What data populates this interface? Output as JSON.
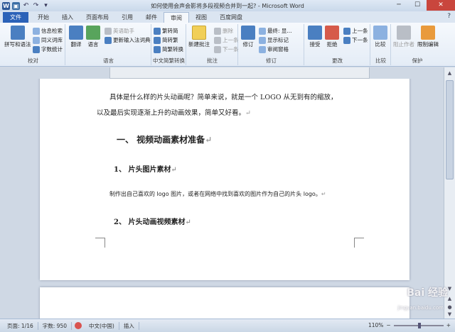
{
  "window": {
    "title": "如何使用会声会影将多段视频合并到一起? - Microsoft Word",
    "minimize": "─",
    "maximize": "☐",
    "close": "✕"
  },
  "quick_access": {
    "app_icon": "W",
    "save": "▣",
    "undo": "↶",
    "redo": "↷",
    "more": "▾"
  },
  "tabs": [
    "文件",
    "开始",
    "插入",
    "页面布局",
    "引用",
    "邮件",
    "审阅",
    "视图",
    "百度网盘"
  ],
  "active_tab": "审阅",
  "help_icon": "?",
  "ribbon": {
    "proofing": {
      "label": "校对",
      "spelling": "拼写和语法",
      "research": "信息检索",
      "thesaurus": "同义词库",
      "word_count": "字数统计"
    },
    "language": {
      "label": "语言",
      "translate": "翻译",
      "language": "语言",
      "eng_assist": "英语助手",
      "update_ime": "更新输入法词典"
    },
    "chinese": {
      "label": "中文简繁转换",
      "to_trad": "繁转简",
      "to_simp": "简转繁",
      "convert": "简繁转换"
    },
    "comments": {
      "label": "批注",
      "new_comment": "新建批注",
      "delete": "删除",
      "prev": "上一条",
      "next": "下一条"
    },
    "tracking": {
      "label": "修订",
      "track": "修订",
      "final_display": "最终: 显...",
      "show_markup": "显示标记",
      "review_pane": "审阅窗格"
    },
    "changes": {
      "label": "更改",
      "accept": "接受",
      "reject": "拒绝",
      "prev": "上一条",
      "next": "下一条"
    },
    "compare": {
      "label": "比较",
      "compare": "比较"
    },
    "protect": {
      "label": "保护",
      "block_authors": "阻止作者",
      "restrict": "限制编辑"
    }
  },
  "document": {
    "para1": "具体是什么样的片头动画呢？简单来说，就是一个 LOGO 从无到有的缩放，",
    "para2": "以及最后实现逐渐上升的动画效果，简单又好看。",
    "heading1": "一、    视频动画素材准备",
    "heading2a": "1、    片头图片素材",
    "body1": "制作出自己喜欢的 logo 图片，或者在网络中找到喜欢的图片作为自己的片头 logo。",
    "heading2b": "2、    片头动画视频素材",
    "para_mark": "↵"
  },
  "status_bar": {
    "page": "页面: 1/16",
    "words": "字数: 950",
    "language": "中文(中国)",
    "insert": "插入",
    "zoom": "110%",
    "zoom_level_percent": 110
  },
  "watermark": {
    "main": "Bai 经验",
    "sub": "jingyan.baidu.com"
  }
}
